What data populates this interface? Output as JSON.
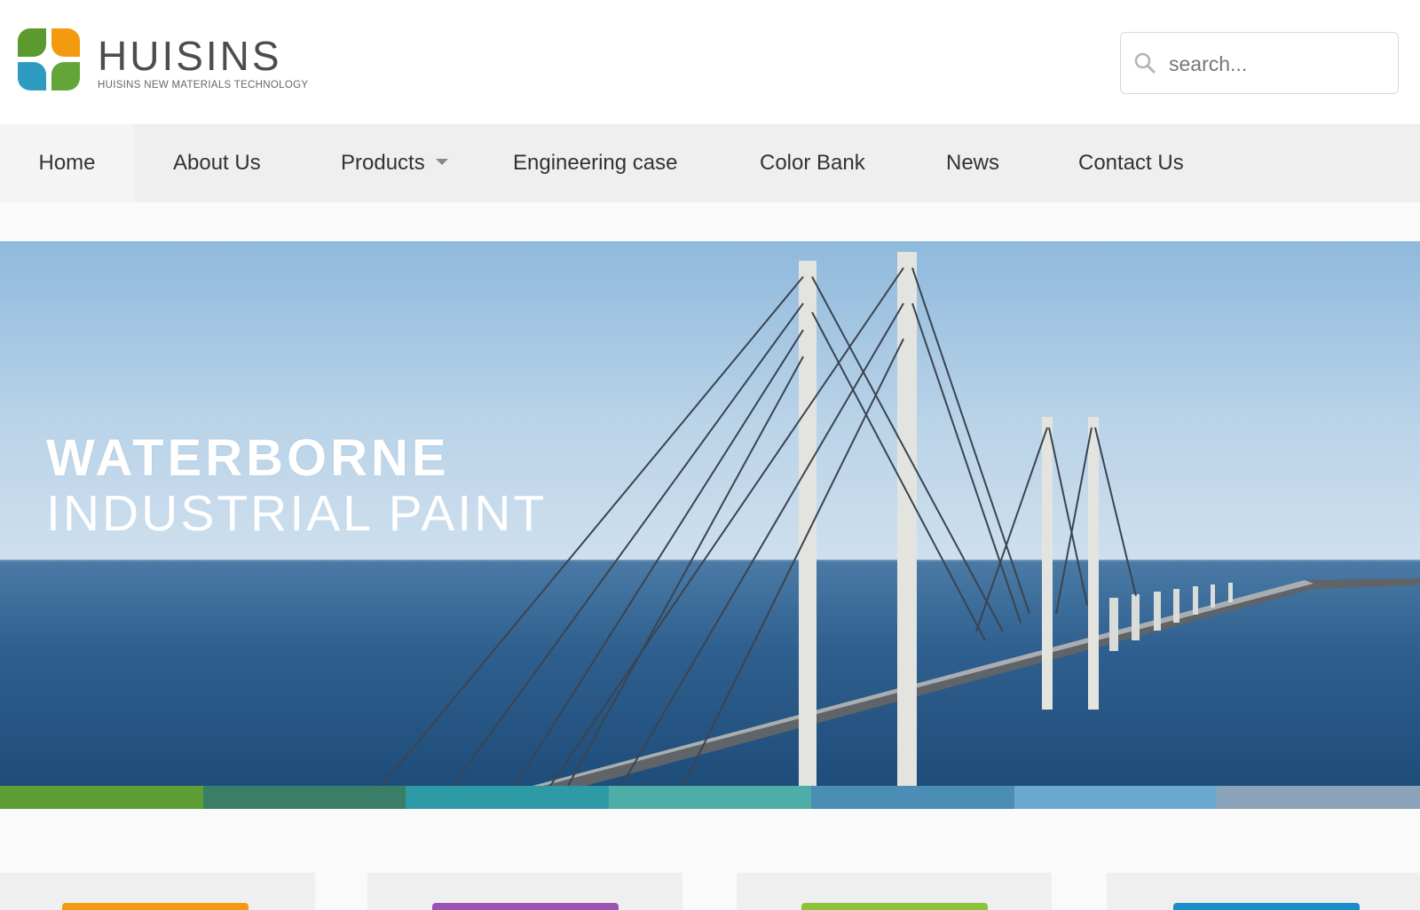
{
  "logo": {
    "name": "HUISINS",
    "subtitle": "HUISINS NEW MATERIALS TECHNOLOGY",
    "colors": [
      "#5b9a2e",
      "#f39a10",
      "#2f9bc0",
      "#64a53a"
    ]
  },
  "search": {
    "placeholder": "search..."
  },
  "nav": {
    "items": [
      {
        "label": "Home"
      },
      {
        "label": "About Us"
      },
      {
        "label": "Products"
      },
      {
        "label": "Engineering case"
      },
      {
        "label": "Color Bank"
      },
      {
        "label": "News"
      },
      {
        "label": "Contact Us"
      }
    ]
  },
  "banner": {
    "line1": "WATERBORNE",
    "line2": "INDUSTRIAL PAINT"
  },
  "stripe_colors": [
    "#5f9e34",
    "#3b7e67",
    "#2e9aa6",
    "#4eaea7",
    "#4c8db5",
    "#6aaad1",
    "#8aa3b9"
  ],
  "cards": [
    {
      "accent": "#f39a10"
    },
    {
      "accent": "#9a55b4"
    },
    {
      "accent": "#8cc23a"
    },
    {
      "accent": "#1a8cc8"
    }
  ]
}
